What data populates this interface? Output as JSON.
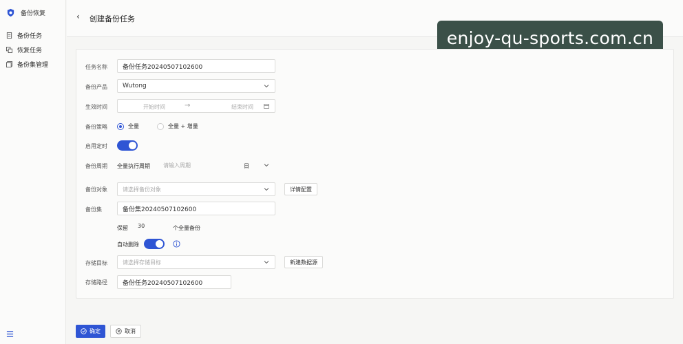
{
  "sidebar": {
    "brand": "备份恢复",
    "items": [
      {
        "label": "备份任务",
        "icon": "backup-doc-icon"
      },
      {
        "label": "恢复任务",
        "icon": "restore-icon"
      },
      {
        "label": "备份集管理",
        "icon": "backup-set-icon"
      }
    ]
  },
  "header": {
    "back": "‹",
    "title": "创建备份任务"
  },
  "watermark": "enjoy-qu-sports.com.cn",
  "form": {
    "task_name": {
      "label": "任务名称",
      "value": "备份任务20240507102600"
    },
    "product": {
      "label": "备份产品",
      "value": "Wutong"
    },
    "effective_time": {
      "label": "生效时间",
      "start_placeholder": "开始时间",
      "arrow": "→",
      "end_placeholder": "结束时间"
    },
    "strategy": {
      "label": "备份策略",
      "options": [
        "全量",
        "全量 + 增量"
      ],
      "selected": "全量"
    },
    "enable_timer": {
      "label": "启用定时",
      "on": true
    },
    "cycle": {
      "label": "备份周期",
      "prefix": "全量执行周期",
      "placeholder": "请输入周期",
      "unit": "日"
    },
    "target_object": {
      "label": "备份对象",
      "placeholder": "请选择备份对象",
      "detail_button": "详情配置"
    },
    "backup_set": {
      "label": "备份集",
      "value": "备份集20240507102600"
    },
    "retain": {
      "prefix": "保留",
      "value": "30",
      "suffix": "个全量备份"
    },
    "auto_delete": {
      "label": "自动删除",
      "on": true
    },
    "storage_target": {
      "label": "存储目标",
      "placeholder": "请选择存储目标",
      "new_button": "新建数据源"
    },
    "storage_path": {
      "label": "存储路径",
      "value": "备份任务20240507102600"
    }
  },
  "footer": {
    "confirm": "确定",
    "cancel": "取消"
  },
  "colors": {
    "primary": "#2f55d4",
    "watermark_bg": "#3b5048"
  }
}
